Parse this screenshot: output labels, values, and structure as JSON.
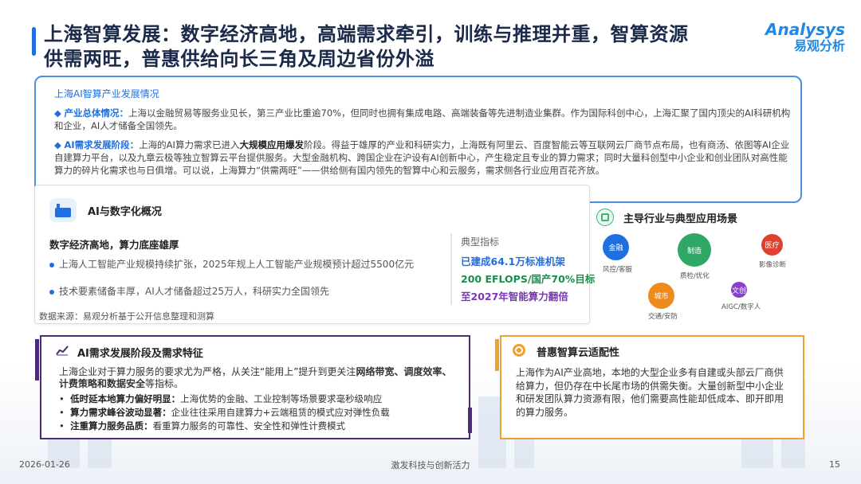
{
  "header": {
    "title_line1": "上海智算发展：数字经济高地，高端需求牵引，训练与推理并重，智算资源",
    "title_line2": "供需两旺，普惠供给向长三角及周边省份外溢",
    "logo_en": "Analysys",
    "logo_cn": "易观分析"
  },
  "overview": {
    "label": "上海AI智算产业发展情况",
    "item1": {
      "key": "产业总体情况：",
      "text": "上海以金融贸易等服务业见长，第三产业比重逾70%，但同时也拥有集成电路、高端装备等先进制造业集群。作为国际科创中心，上海汇聚了国内顶尖的AI科研机构和企业，AI人才储备全国领先。"
    },
    "item2": {
      "key": "AI需求发展阶段：",
      "text_pre": "上海的AI算力需求已进入",
      "text_bold": "大规模应用爆发",
      "text_post": "阶段。得益于雄厚的产业和科研实力，上海既有阿里云、百度智能云等互联网云厂商节点布局，也有商汤、依图等AI企业自建算力平台，以及九章云极等独立智算云平台提供服务。大型金融机构、跨国企业在沪设有AI创新中心，产生稳定且专业的算力需求；同时大量科创型中小企业和创业团队对高性能算力的碎片化需求也与日俱增。可以说，上海算力“供需两旺”——供给侧有国内领先的智算中心和云服务，需求侧各行业应用百花齐放。"
    }
  },
  "ai": {
    "title": "AI与数字化概况",
    "subtitle": "数字经济高地，算力底座雄厚",
    "item1": "上海人工智能产业规模持续扩张，2025年规上人工智能产业规模预计超过5500亿元",
    "item2": "技术要素储备丰厚，AI人才储备超过25万人，科研实力全国领先",
    "metrics_head": "典型指标",
    "metrics": [
      {
        "text": "已建成64.1万标准机架",
        "color": "#1f6fe0"
      },
      {
        "text": "200 EFLOPS/国产70%目标",
        "color": "#1a8f4a"
      },
      {
        "text": "至2027年智能算力翻倍",
        "color": "#7b35b8"
      }
    ],
    "source": "数据来源：易观分析基于公开信息整理和测算"
  },
  "apps": {
    "title": "主导行业与典型应用场景",
    "bubbles": [
      {
        "name": "金融",
        "label": "风控/客服",
        "color": "#1e6fe0"
      },
      {
        "name": "制造",
        "label": "质检/优化",
        "color": "#2fa866"
      },
      {
        "name": "医疗",
        "label": "影像诊断",
        "color": "#e0402f"
      },
      {
        "name": "城市",
        "label": "交通/安防",
        "color": "#ef8a1c"
      },
      {
        "name": "文创",
        "label": "AIGC/数字人",
        "color": "#8a3fd0"
      }
    ]
  },
  "demand": {
    "title": "AI需求发展阶段及需求特征",
    "intro_pre": "上海企业对于算力服务的要求尤为严格，从关注“能用上”提升到更关注",
    "intro_bold1": "网络带宽、调度效率、计费策略和数据安全",
    "intro_post": "等指标。",
    "items": [
      {
        "key": "低时延本地算力偏好明显：",
        "text": "上海优势的金融、工业控制等场景要求毫秒级响应"
      },
      {
        "key": "算力需求峰谷波动显著：",
        "text": "企业往往采用自建算力+云端租赁的模式应对弹性负载"
      },
      {
        "key": "注重算力服务品质：",
        "text": "看重算力服务的可靠性、安全性和弹性计费模式"
      }
    ]
  },
  "cloud": {
    "title": "普惠智算云适配性",
    "body": "上海作为AI产业高地，本地的大型企业多有自建或头部云厂商供给算力，但仍存在中长尾市场的供需失衡。大量创新型中小企业和研发团队算力资源有限，他们需要高性能却低成本、即开即用的算力服务。"
  },
  "footer": {
    "date": "2026-01-26",
    "center": "激发科技与创新活力",
    "page": "15"
  }
}
